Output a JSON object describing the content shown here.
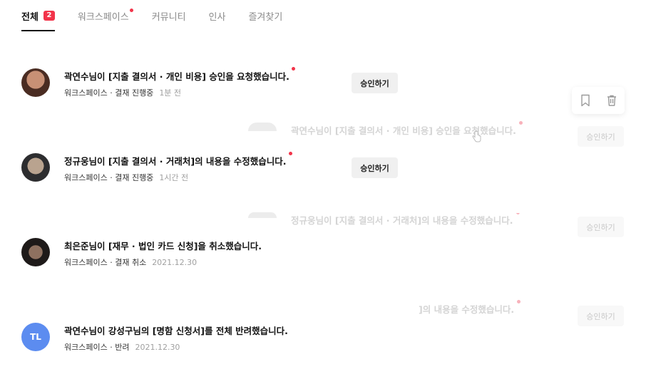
{
  "tabs": [
    {
      "label": "전체",
      "badge": "2",
      "active": true
    },
    {
      "label": "워크스페이스",
      "dot": true
    },
    {
      "label": "커뮤니티"
    },
    {
      "label": "인사"
    },
    {
      "label": "즐겨찾기"
    }
  ],
  "notifications": [
    {
      "title": "곽연수님이 [지출 결의서 · 개인 비용] 승인을 요청했습니다.",
      "meta": "워크스페이스 · 결재 진행중",
      "time": "1분 전",
      "button": "승인하기"
    },
    {
      "title": "정규웅님이 [지출 결의서 · 거래처]의 내용을 수정했습니다.",
      "meta": "워크스페이스 · 결재 진행중",
      "time": "1시간 전",
      "button": "승인하기"
    },
    {
      "title": "최은준님이 [재무 · 법인 카드 신청]을 취소했습니다.",
      "meta": "워크스페이스 · 결재 취소",
      "time": "2021.12.30"
    },
    {
      "title": "곽연수님이 강성구님의 [명함 신청서]를 전체 반려했습니다.",
      "meta": "워크스페이스 · 반려",
      "time": "2021.12.30",
      "avatar_initials": "TL"
    }
  ],
  "ghosts": [
    {
      "text": "곽연수님이 [지출 결의서 · 개인 비용] 승인을 요청했습니다.",
      "button": "승인하기"
    },
    {
      "text": "정규웅님이 [지출 결의서 · 거래처]의 내용을 수정했습니다.",
      "button": "승인하기"
    },
    {
      "text": "]의 내용을 수정했습니다.",
      "button": "승인하기"
    }
  ],
  "actions": {
    "bookmark_icon": "bookmark-icon",
    "delete_icon": "trash-icon"
  },
  "colors": {
    "accent_red": "#f2344a",
    "initials_avatar": "#5c8cf0"
  }
}
